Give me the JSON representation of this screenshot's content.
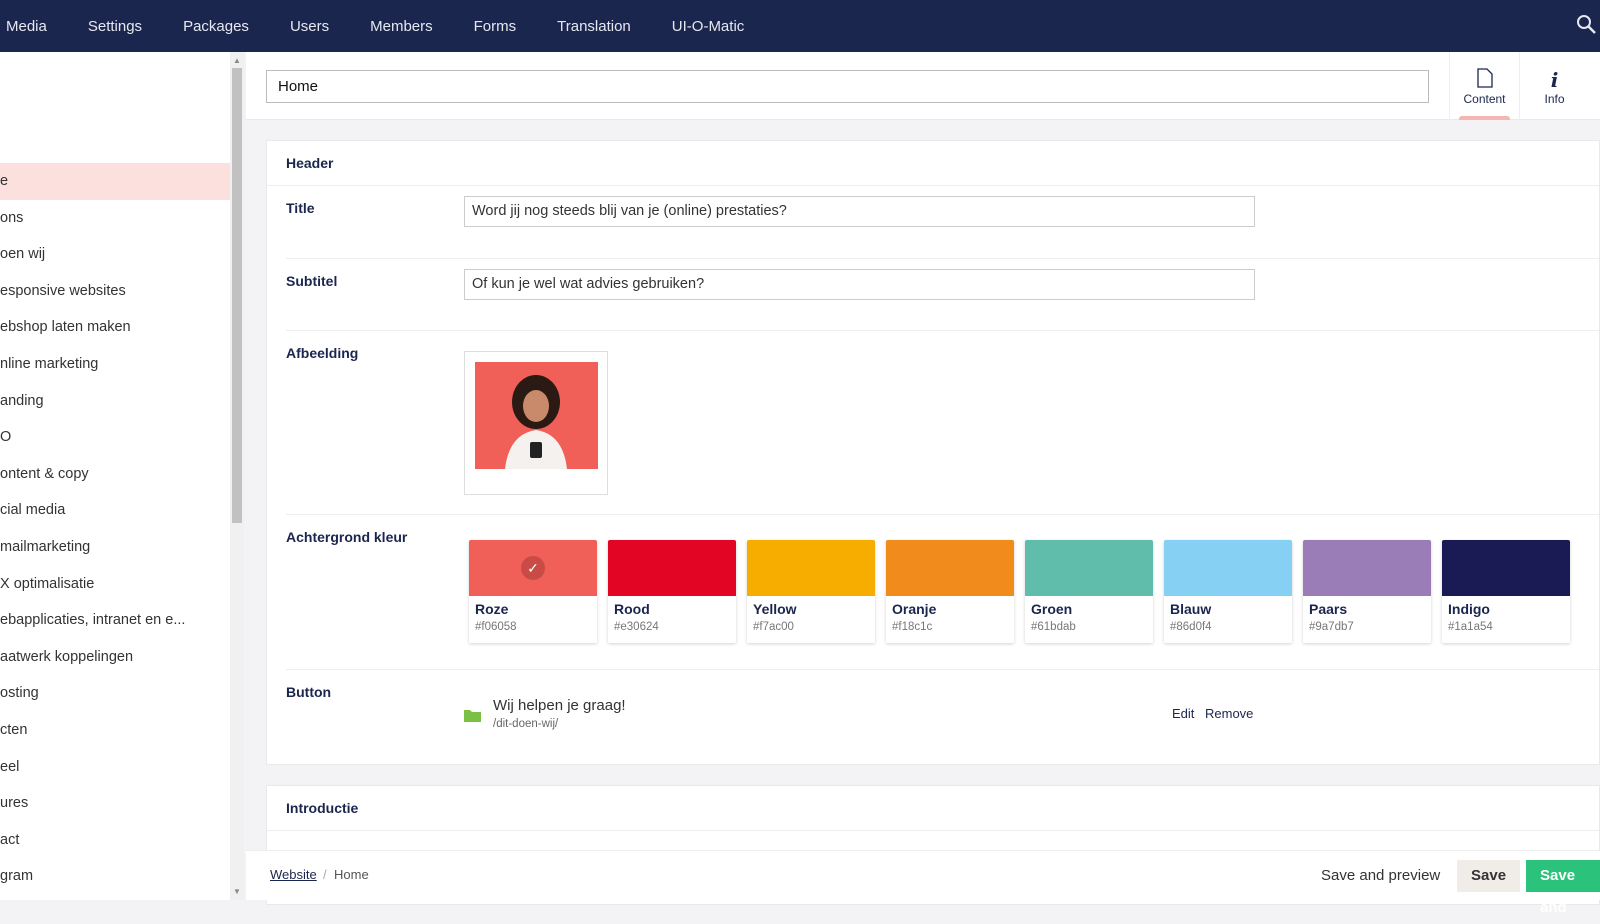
{
  "topnav": [
    "Media",
    "Settings",
    "Packages",
    "Users",
    "Members",
    "Forms",
    "Translation",
    "UI-O-Matic"
  ],
  "sidebar": {
    "items": [
      "e",
      "ons",
      "oen wij",
      "esponsive websites",
      "ebshop laten maken",
      "nline marketing",
      "anding",
      "O",
      "ontent & copy",
      "cial media",
      "mailmarketing",
      "X optimalisatie",
      "ebapplicaties, intranet en e...",
      "aatwerk koppelingen",
      "osting",
      "cten",
      "eel",
      "ures",
      "act",
      "gram"
    ],
    "active_index": 0
  },
  "node_name": "Home",
  "apps": [
    {
      "label": "Content",
      "icon": "document-icon"
    },
    {
      "label": "Info",
      "icon": "info-icon"
    }
  ],
  "header_panel": {
    "title": "Header",
    "title_field": {
      "label": "Title",
      "value": "Word jij nog steeds blij van je (online) prestaties?"
    },
    "subtitle_field": {
      "label": "Subtitel",
      "value": "Of kun je wel wat advies gebruiken?"
    },
    "image_field": {
      "label": "Afbeelding"
    },
    "color_field": {
      "label": "Achtergrond kleur",
      "selected": "Roze",
      "colors": [
        {
          "name": "Roze",
          "hex": "#f06058"
        },
        {
          "name": "Rood",
          "hex": "#e30624"
        },
        {
          "name": "Yellow",
          "hex": "#f7ac00"
        },
        {
          "name": "Oranje",
          "hex": "#f18c1c"
        },
        {
          "name": "Groen",
          "hex": "#61bdab"
        },
        {
          "name": "Blauw",
          "hex": "#86d0f4"
        },
        {
          "name": "Paars",
          "hex": "#9a7db7"
        },
        {
          "name": "Indigo",
          "hex": "#1a1a54"
        }
      ]
    },
    "button_field": {
      "label": "Button",
      "link_name": "Wij helpen je graag!",
      "link_url": "/dit-doen-wij/",
      "edit": "Edit",
      "remove": "Remove"
    }
  },
  "intro_panel": {
    "title": "Introductie"
  },
  "footer": {
    "breadcrumb": [
      "Website",
      "Home"
    ],
    "save_preview": "Save and preview",
    "save": "Save",
    "save_publish": "Save and"
  },
  "colors": {
    "topbar": "#1b264f",
    "accent_green": "#2bc37c"
  }
}
